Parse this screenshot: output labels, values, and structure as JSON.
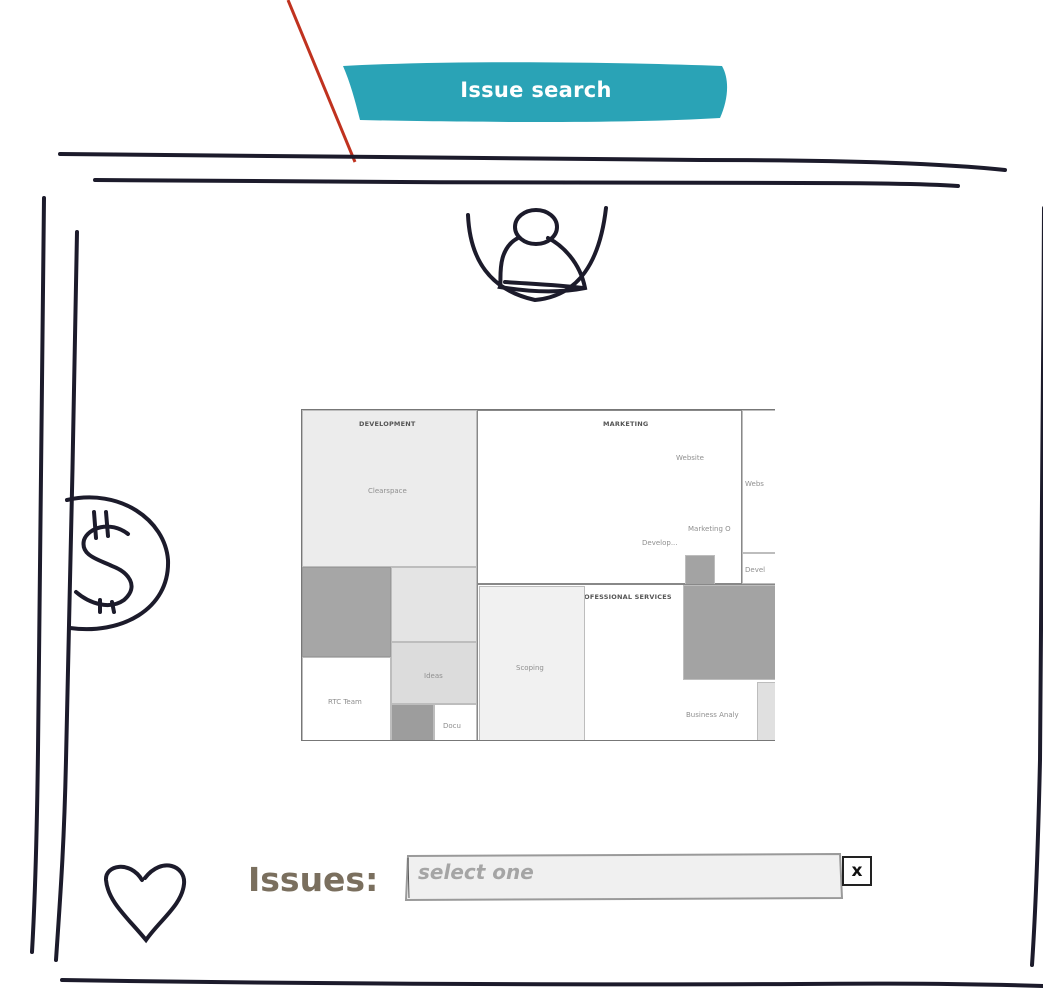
{
  "banner": {
    "label": "Issue search",
    "color": "#2aa3b6"
  },
  "icons": {
    "user": "user-icon",
    "dollar": "dollar-icon",
    "heart": "heart-icon"
  },
  "treemap": {
    "sections": {
      "development": "DEVELOPMENT",
      "marketing": "MARKETING",
      "professional_services": "PROFESSIONAL SERVICES"
    },
    "cells": {
      "clearspace": "Clearspace",
      "rtc_team": "RTC Team",
      "ideas": "Ideas",
      "docu": "Docu",
      "website": "Website",
      "webs": "Webs",
      "marketing_short": "Marketing O",
      "develop": "Develop...",
      "devel": "Devel",
      "scoping": "Scoping",
      "business_analy": "Business Analy"
    }
  },
  "form": {
    "issues_label": "Issues:",
    "issues_placeholder": "select one",
    "clear_label": "x"
  }
}
